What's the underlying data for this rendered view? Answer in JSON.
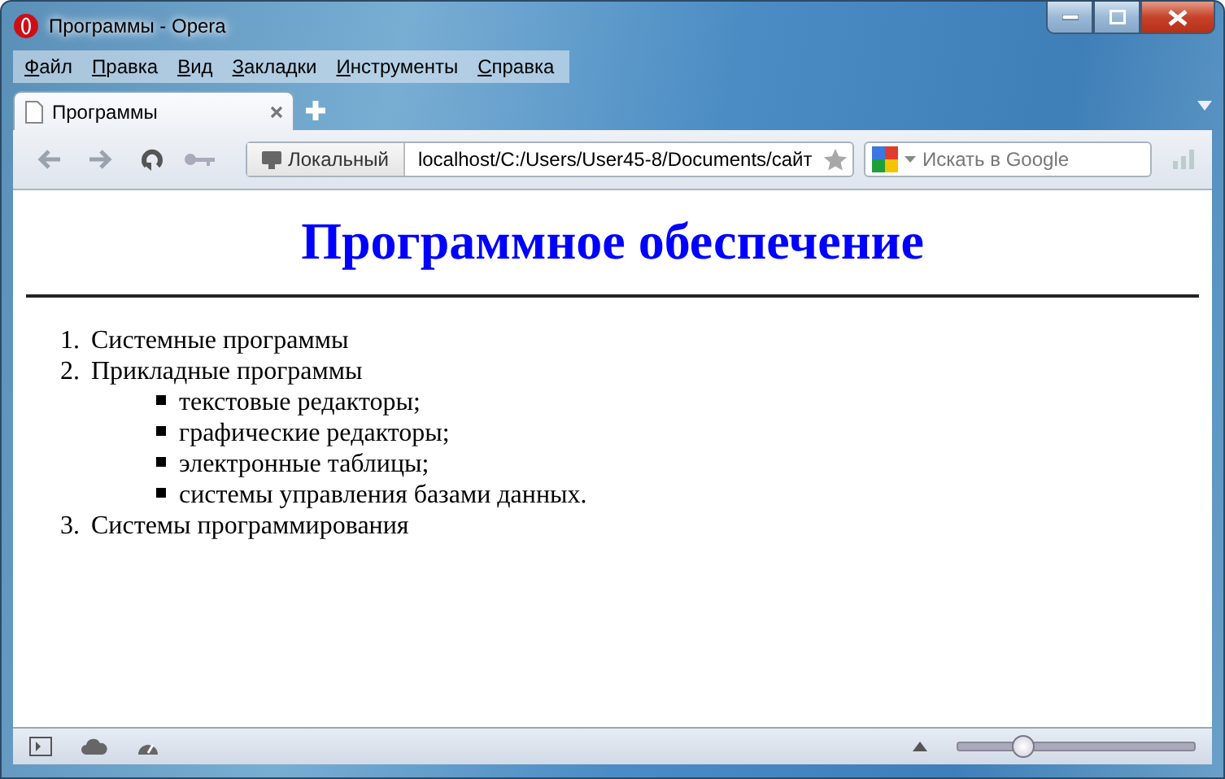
{
  "window": {
    "title": "Программы - Opera"
  },
  "menu": [
    "Файл",
    "Правка",
    "Вид",
    "Закладки",
    "Инструменты",
    "Справка"
  ],
  "tabs": [
    {
      "label": "Программы",
      "selected": true
    }
  ],
  "address": {
    "badge": "Локальный",
    "url": "localhost/C:/Users/User45-8/Documents/сайт"
  },
  "search": {
    "placeholder": "Искать в Google"
  },
  "page": {
    "heading": "Программное обеспечение",
    "list": [
      {
        "marker": "1.",
        "text": "Системные программы"
      },
      {
        "marker": "2.",
        "text": "Прикладные программы",
        "children": [
          {
            "text": "текстовые редакторы;"
          },
          {
            "text": "графические редакторы;"
          },
          {
            "text": "электронные таблицы;"
          },
          {
            "text": "системы управления базами данных."
          }
        ]
      },
      {
        "marker": "3.",
        "text": "Системы программирования"
      }
    ]
  },
  "zoom": {
    "level": 0.28
  }
}
